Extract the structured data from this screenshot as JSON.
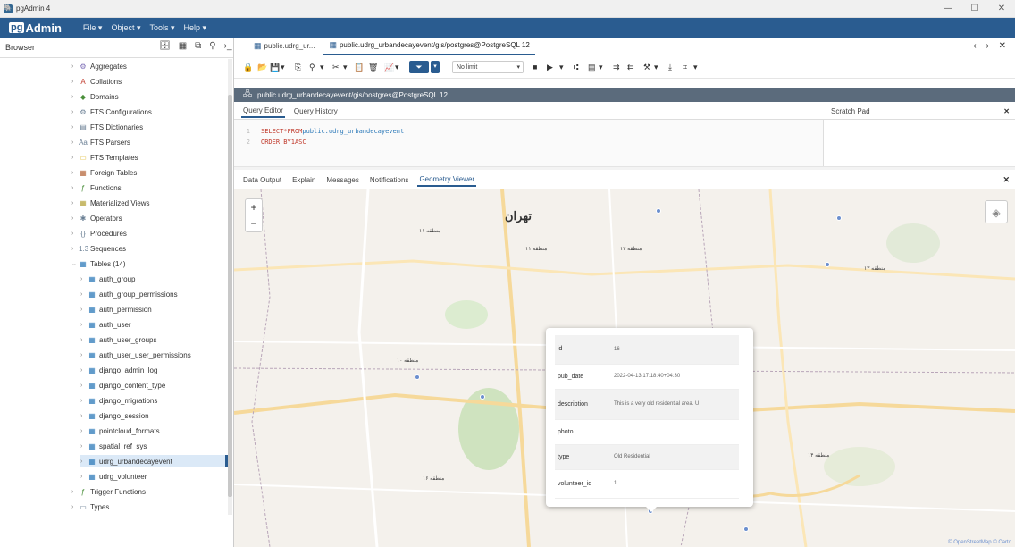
{
  "window": {
    "title": "pgAdmin 4",
    "controls": [
      "—",
      "☐",
      "✕"
    ]
  },
  "menubar": {
    "logo_pg": "pg",
    "logo_text": "Admin",
    "items": [
      "File ▾",
      "Object ▾",
      "Tools ▾",
      "Help ▾"
    ]
  },
  "browser": {
    "title": "Browser",
    "tree": [
      {
        "label": "Aggregates",
        "icon": "⚙",
        "color": "#7a6bb5"
      },
      {
        "label": "Collations",
        "icon": "A",
        "color": "#c0392b"
      },
      {
        "label": "Domains",
        "icon": "◆",
        "color": "#4a8f3a"
      },
      {
        "label": "FTS Configurations",
        "icon": "⚙",
        "color": "#6a7f94"
      },
      {
        "label": "FTS Dictionaries",
        "icon": "▤",
        "color": "#6a7f94"
      },
      {
        "label": "FTS Parsers",
        "icon": "Aa",
        "color": "#6a7f94"
      },
      {
        "label": "FTS Templates",
        "icon": "▭",
        "color": "#e2c24a"
      },
      {
        "label": "Foreign Tables",
        "icon": "▦",
        "color": "#b5663a"
      },
      {
        "label": "Functions",
        "icon": "ƒ",
        "color": "#4a8f3a"
      },
      {
        "label": "Materialized Views",
        "icon": "▦",
        "color": "#b5a33a"
      },
      {
        "label": "Operators",
        "icon": "✱",
        "color": "#6a7f94"
      },
      {
        "label": "Procedures",
        "icon": "{}",
        "color": "#6a7f94"
      },
      {
        "label": "Sequences",
        "icon": "1.3",
        "color": "#6a7f94"
      },
      {
        "label": "Tables (14)",
        "icon": "▦",
        "color": "#2a78b8"
      },
      {
        "label": "auth_group",
        "icon": "▦",
        "color": "#2a78b8"
      },
      {
        "label": "auth_group_permissions",
        "icon": "▦",
        "color": "#2a78b8"
      },
      {
        "label": "auth_permission",
        "icon": "▦",
        "color": "#2a78b8"
      },
      {
        "label": "auth_user",
        "icon": "▦",
        "color": "#2a78b8"
      },
      {
        "label": "auth_user_groups",
        "icon": "▦",
        "color": "#2a78b8"
      },
      {
        "label": "auth_user_user_permissions",
        "icon": "▦",
        "color": "#2a78b8"
      },
      {
        "label": "django_admin_log",
        "icon": "▦",
        "color": "#2a78b8"
      },
      {
        "label": "django_content_type",
        "icon": "▦",
        "color": "#2a78b8"
      },
      {
        "label": "django_migrations",
        "icon": "▦",
        "color": "#2a78b8"
      },
      {
        "label": "django_session",
        "icon": "▦",
        "color": "#2a78b8"
      },
      {
        "label": "pointcloud_formats",
        "icon": "▦",
        "color": "#2a78b8"
      },
      {
        "label": "spatial_ref_sys",
        "icon": "▦",
        "color": "#2a78b8"
      },
      {
        "label": "udrg_urbandecayevent",
        "icon": "▦",
        "color": "#2a78b8"
      },
      {
        "label": "udrg_volunteer",
        "icon": "▦",
        "color": "#2a78b8"
      },
      {
        "label": "Trigger Functions",
        "icon": "ƒ",
        "color": "#4a8f3a"
      },
      {
        "label": "Types",
        "icon": "▭",
        "color": "#6a7f94"
      }
    ]
  },
  "tabs": {
    "items": [
      {
        "label": "public.udrg_ur...",
        "active": false
      },
      {
        "label": "public.udrg_urbandecayevent/gis/postgres@PostgreSQL 12",
        "active": true
      }
    ],
    "nav": "‹ › ✕"
  },
  "toolbar": {
    "limit_label": "No limit"
  },
  "connection": {
    "text": "public.udrg_urbandecayevent/gis/postgres@PostgreSQL 12"
  },
  "query": {
    "tabs": [
      "Query Editor",
      "Query History"
    ],
    "lines": [
      {
        "no": "1",
        "kw1": "SELECT",
        "mid": " * ",
        "kw2": "FROM",
        "rest": " public.udrg_urbandecayevent"
      },
      {
        "no": "2",
        "kw1": "ORDER BY",
        "mid": " 1",
        "kw2": " ASC",
        "rest": ""
      }
    ],
    "scratch_title": "Scratch Pad"
  },
  "results": {
    "tabs": [
      "Data Output",
      "Explain",
      "Messages",
      "Notifications",
      "Geometry Viewer"
    ],
    "active": "Geometry Viewer"
  },
  "map": {
    "city": "تهران",
    "districts": [
      "منطقه ۱۱",
      "منطقه ۱۱",
      "منطقه ۱۲",
      "منطقه ۱۳",
      "منطقه ۱۰",
      "منطقه ۱۶",
      "منطقه ۱۴"
    ],
    "attribution": "© OpenStreetMap © Carto"
  },
  "popup": {
    "rows": [
      {
        "key": "id",
        "value": "16"
      },
      {
        "key": "pub_date",
        "value": "2022-04-13 17:18:40+04:30"
      },
      {
        "key": "description",
        "value": "This is a very old residential area. U"
      },
      {
        "key": "photo",
        "value": ""
      },
      {
        "key": "type",
        "value": "Old Residential"
      },
      {
        "key": "volunteer_id",
        "value": "1"
      }
    ]
  },
  "colors": {
    "accent": "#2a5c90",
    "connbar": "#5b6b7c"
  }
}
